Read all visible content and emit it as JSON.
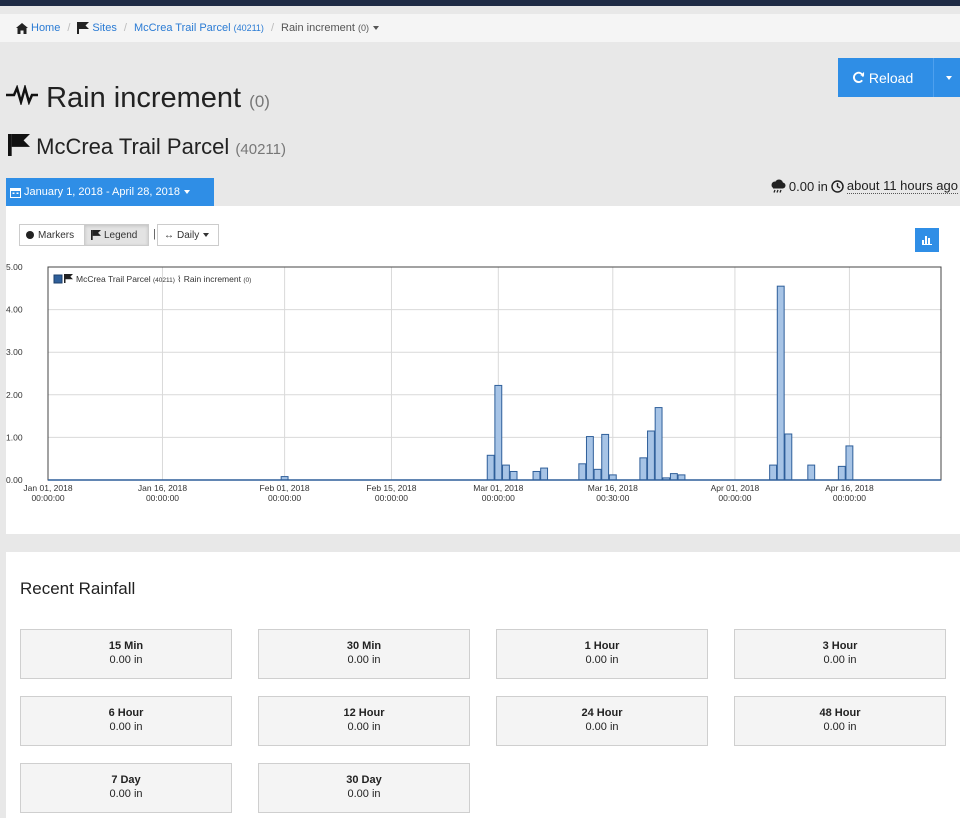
{
  "breadcrumb": {
    "home": "Home",
    "sites": "Sites",
    "site": "McCrea Trail Parcel",
    "site_id": "(40211)",
    "current": "Rain increment",
    "current_id": "(0)"
  },
  "header": {
    "sensor_title": "Rain increment",
    "sensor_id": "(0)",
    "site_title": "McCrea Trail Parcel",
    "site_id": "(40211)",
    "reload_label": "Reload"
  },
  "date_range": "January 1, 2018 - April 28, 2018",
  "status": {
    "value": "0.00 in",
    "ago": "about 11 hours ago"
  },
  "toolbar": {
    "markers": "Markers",
    "legend": "Legend",
    "interval": "Daily"
  },
  "colors": {
    "accent": "#2f8ee6",
    "bar_fill": "#a7c4e6",
    "bar_stroke": "#2f5f9a",
    "line": "#2f5f9a"
  },
  "chart_data": {
    "type": "bar",
    "legend": {
      "site": "McCrea Trail Parcel",
      "site_id": "(40211)",
      "sensor": "Rain increment",
      "sensor_id": "(0)"
    },
    "ylim": [
      0,
      5
    ],
    "y_ticks": [
      "0.00",
      "1.00",
      "2.00",
      "3.00",
      "4.00",
      "5.00"
    ],
    "x_ticks": [
      {
        "date": "Jan 01, 2018",
        "time": "00:00:00",
        "day": 0
      },
      {
        "date": "Jan 16, 2018",
        "time": "00:00:00",
        "day": 15
      },
      {
        "date": "Feb 01, 2018",
        "time": "00:00:00",
        "day": 31
      },
      {
        "date": "Feb 15, 2018",
        "time": "00:00:00",
        "day": 45
      },
      {
        "date": "Mar 01, 2018",
        "time": "00:00:00",
        "day": 59
      },
      {
        "date": "Mar 16, 2018",
        "time": "00:30:00",
        "day": 74
      },
      {
        "date": "Apr 01, 2018",
        "time": "00:00:00",
        "day": 90
      },
      {
        "date": "Apr 16, 2018",
        "time": "00:00:00",
        "day": 105
      }
    ],
    "series": [
      {
        "name": "Rain increment",
        "points": [
          {
            "day": 31,
            "value": 0.08
          },
          {
            "day": 58,
            "value": 0.58
          },
          {
            "day": 59,
            "value": 2.22
          },
          {
            "day": 60,
            "value": 0.35
          },
          {
            "day": 61,
            "value": 0.2
          },
          {
            "day": 64,
            "value": 0.2
          },
          {
            "day": 65,
            "value": 0.28
          },
          {
            "day": 70,
            "value": 0.38
          },
          {
            "day": 71,
            "value": 1.02
          },
          {
            "day": 72,
            "value": 0.25
          },
          {
            "day": 73,
            "value": 1.07
          },
          {
            "day": 74,
            "value": 0.12
          },
          {
            "day": 78,
            "value": 0.52
          },
          {
            "day": 79,
            "value": 1.15
          },
          {
            "day": 80,
            "value": 1.7
          },
          {
            "day": 81,
            "value": 0.05
          },
          {
            "day": 82,
            "value": 0.15
          },
          {
            "day": 83,
            "value": 0.12
          },
          {
            "day": 95,
            "value": 0.35
          },
          {
            "day": 96,
            "value": 4.55
          },
          {
            "day": 97,
            "value": 1.08
          },
          {
            "day": 100,
            "value": 0.35
          },
          {
            "day": 104,
            "value": 0.32
          },
          {
            "day": 105,
            "value": 0.8
          }
        ]
      }
    ]
  },
  "recent": {
    "title": "Recent Rainfall",
    "tiles": [
      {
        "label": "15 Min",
        "value": "0.00 in"
      },
      {
        "label": "30 Min",
        "value": "0.00 in"
      },
      {
        "label": "1 Hour",
        "value": "0.00 in"
      },
      {
        "label": "3 Hour",
        "value": "0.00 in"
      },
      {
        "label": "6 Hour",
        "value": "0.00 in"
      },
      {
        "label": "12 Hour",
        "value": "0.00 in"
      },
      {
        "label": "24 Hour",
        "value": "0.00 in"
      },
      {
        "label": "48 Hour",
        "value": "0.00 in"
      },
      {
        "label": "7 Day",
        "value": "0.00 in"
      },
      {
        "label": "30 Day",
        "value": "0.00 in"
      }
    ]
  }
}
